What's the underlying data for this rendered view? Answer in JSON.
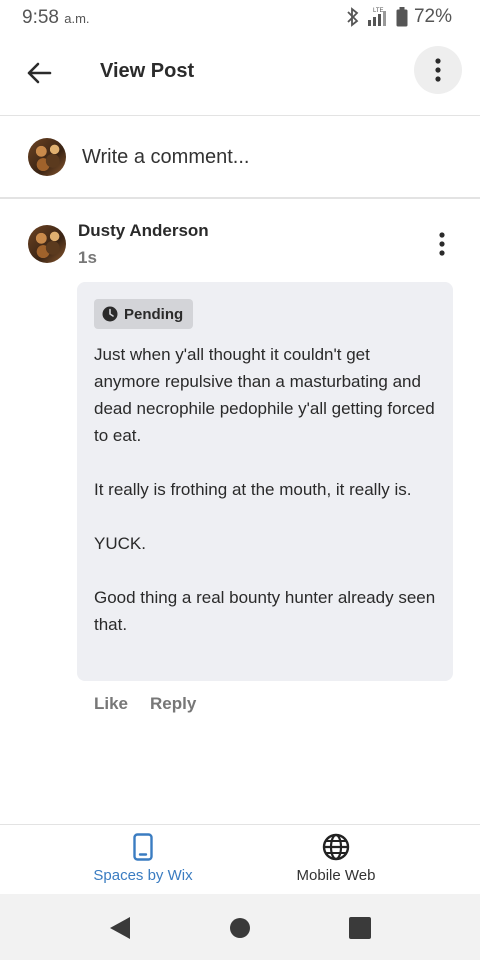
{
  "status_bar": {
    "time": "9:58",
    "ampm": "a.m.",
    "network": "LTE",
    "battery": "72%"
  },
  "app_bar": {
    "title": "View Post",
    "back_icon": "arrow-left-icon",
    "more_icon": "more-vertical-icon"
  },
  "composer": {
    "placeholder": "Write a comment..."
  },
  "comment": {
    "author": "Dusty Anderson",
    "age": "1s",
    "status_badge": "Pending",
    "paragraphs": [
      "Just when y'all thought it couldn't get anymore repulsive than a masturbating and dead necrophile pedophile y'all getting forced to eat.",
      "It really is frothing at the mouth, it really is.",
      "YUCK.",
      "Good thing a real bounty hunter already seen that."
    ],
    "actions": {
      "like": "Like",
      "reply": "Reply"
    }
  },
  "bottom_tabs": [
    {
      "label": "Spaces by Wix",
      "icon": "phone-icon",
      "active": true
    },
    {
      "label": "Mobile Web",
      "icon": "globe-icon",
      "active": false
    }
  ],
  "colors": {
    "accent": "#3a7cc1",
    "bubble": "#eeeff3",
    "badge": "#d3d4d8"
  }
}
